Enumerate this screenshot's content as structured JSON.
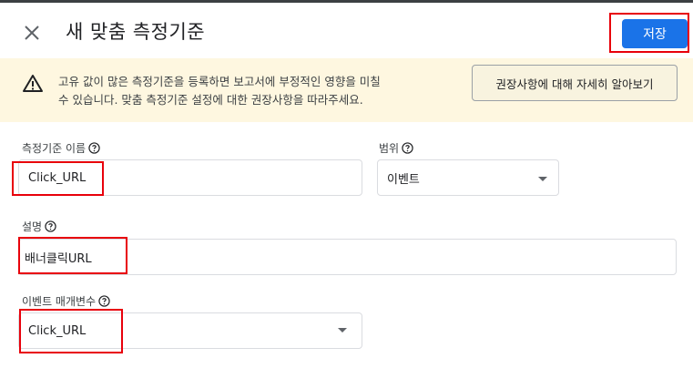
{
  "header": {
    "title": "새 맞춤 측정기준",
    "save_label": "저장"
  },
  "banner": {
    "line1": "고유 값이 많은 측정기준을 등록하면 보고서에 부정적인 영향을 미칠",
    "line2": "수 있습니다. 맞춤 측정기준 설정에 대한 권장사항을 따라주세요.",
    "learn_more": "권장사항에 대해 자세히 알아보기"
  },
  "form": {
    "dimension_name_label": "측정기준 이름",
    "dimension_name_value": "Click_URL",
    "scope_label": "범위",
    "scope_value": "이벤트",
    "description_label": "설명",
    "description_value": "배너클릭URL",
    "event_param_label": "이벤트 매개변수",
    "event_param_value": "Click_URL"
  },
  "colors": {
    "primary": "#1a73e8",
    "banner_bg": "#fef7e0",
    "highlight": "#e8000b"
  }
}
